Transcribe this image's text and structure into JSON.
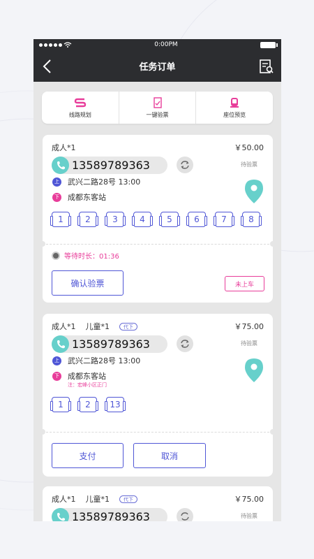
{
  "status_bar": {
    "time": "0:00PM"
  },
  "header": {
    "title": "任务订单"
  },
  "toolbar": [
    {
      "label": "线路规划",
      "icon": "route-icon"
    },
    {
      "label": "一键验票",
      "icon": "ticket-check-icon"
    },
    {
      "label": "座位预览",
      "icon": "seat-icon"
    }
  ],
  "orders": [
    {
      "passengers": "成人*1",
      "child": "",
      "tag": "",
      "price": "￥50.00",
      "phone": "13589789363",
      "status": "待验票",
      "pickup_badge": "上",
      "pickup": "武兴二路28号  13:00",
      "dropoff_badge": "下",
      "dropoff": "成都东客站",
      "note": "",
      "seats": [
        "1",
        "2",
        "3",
        "4",
        "5",
        "6",
        "7",
        "8"
      ],
      "wait_label": "等待时长：01:36",
      "primary_button": "确认验票",
      "secondary_button": "未上车"
    },
    {
      "passengers": "成人*1",
      "child": "儿童*1",
      "tag": "代下",
      "price": "￥75.00",
      "phone": "13589789363",
      "status": "待验票",
      "pickup_badge": "上",
      "pickup": "武兴二路28号  13:00",
      "dropoff_badge": "下",
      "dropoff": "成都东客站",
      "note": "注：宏峰小区正门",
      "seats": [
        "1",
        "2",
        "13"
      ],
      "pay_button": "支付",
      "cancel_button": "取消"
    },
    {
      "passengers": "成人*1",
      "child": "儿童*1",
      "tag": "代下",
      "price": "￥75.00",
      "phone": "13589789363",
      "status": "待验票"
    }
  ],
  "colors": {
    "accent": "#4f56d6",
    "pink": "#e83d9a",
    "teal": "#67d0cb",
    "header": "#2c2d30"
  }
}
